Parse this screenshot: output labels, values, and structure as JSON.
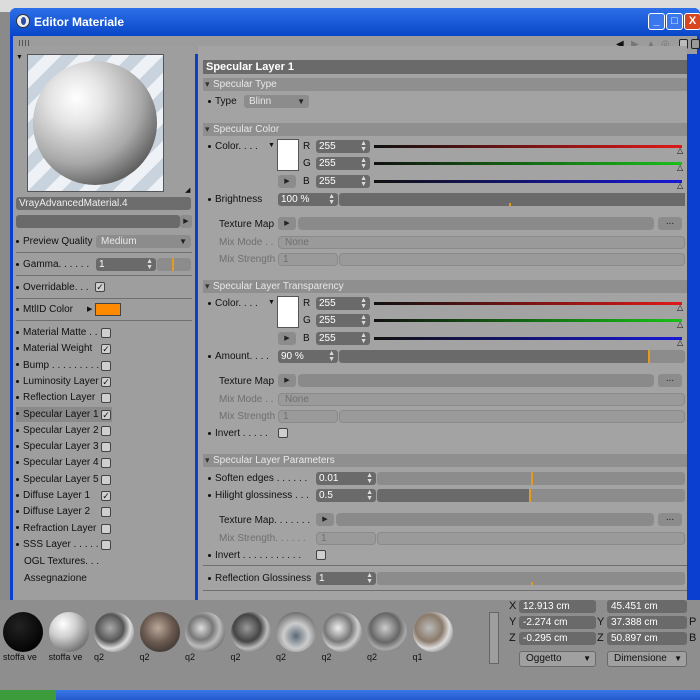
{
  "window": {
    "title": "Editor Materiale",
    "min": "_",
    "max": "□",
    "close": "X"
  },
  "material": {
    "name": "VrayAdvancedMaterial.4"
  },
  "left": {
    "preview_quality_label": "Preview Quality",
    "preview_quality_value": "Medium",
    "gamma_label": "Gamma. . . . . .",
    "gamma_value": "1",
    "overridable_label": "Overridable. . .",
    "mtlid_label": "MtlID Color",
    "mtlid_color": "#ff8a00",
    "channels": [
      {
        "label": "Material Matte . .",
        "checked": false
      },
      {
        "label": "Material Weight",
        "checked": true
      },
      {
        "label": "Bump . . . . . . . . .",
        "checked": false
      },
      {
        "label": "Luminosity Layer",
        "checked": true
      },
      {
        "label": "Reflection Layer",
        "checked": false
      },
      {
        "label": "Specular Layer 1",
        "checked": true
      },
      {
        "label": "Specular Layer 2",
        "checked": false
      },
      {
        "label": "Specular Layer 3",
        "checked": false
      },
      {
        "label": "Specular Layer 4",
        "checked": false
      },
      {
        "label": "Specular Layer 5",
        "checked": false
      },
      {
        "label": "Diffuse Layer 1",
        "checked": true
      },
      {
        "label": "Diffuse Layer 2",
        "checked": false
      },
      {
        "label": "Refraction Layer",
        "checked": false
      },
      {
        "label": "SSS Layer . . . . . .",
        "checked": false
      }
    ],
    "ogl_textures": "OGL Textures. . .",
    "assegnazione": "Assegnazione"
  },
  "right": {
    "header": "Specular Layer 1",
    "type_section": {
      "title": "Specular Type",
      "type_label": "Type",
      "type_value": "Blinn"
    },
    "color_section": {
      "title": "Specular Color",
      "color_label": "Color. . . .",
      "r_label": "R",
      "g_label": "G",
      "b_label": "B",
      "r": "255",
      "g": "255",
      "b": "255",
      "brightness_label": "Brightness",
      "brightness_value": "100 %",
      "texture_map_label": "Texture Map",
      "mix_mode_label": "Mix Mode . .",
      "mix_mode_value": "None",
      "mix_strength_label": "Mix Strength",
      "mix_strength_value": "1",
      "dots": "..."
    },
    "transparency_section": {
      "title": "Specular Layer Transparency",
      "color_label": "Color. . . .",
      "r_label": "R",
      "g_label": "G",
      "b_label": "B",
      "r": "255",
      "g": "255",
      "b": "255",
      "amount_label": "Amount. . . .",
      "amount_value": "90 %",
      "amount_fraction": 0.9,
      "texture_map_label": "Texture Map",
      "mix_mode_label": "Mix Mode . .",
      "mix_mode_value": "None",
      "mix_strength_label": "Mix Strength",
      "mix_strength_value": "1",
      "invert_label": "Invert . . . . .",
      "dots": "..."
    },
    "params_section": {
      "title": "Specular Layer Parameters",
      "soften_label": "Soften edges . . . . . .",
      "soften_value": "0.01",
      "hilight_label": "Hilight glossiness . . .",
      "hilight_value": "0.5",
      "texture_map_label": "Texture Map. . . . . . .",
      "mix_strength_label": "Mix Strength. . . . . .",
      "mix_strength_value": "1",
      "invert_label": "Invert . . . . . . . . . . .",
      "reflection_gloss_label": "Reflection Glossiness",
      "reflection_gloss_value": "1",
      "dots": "..."
    },
    "colors": {
      "red": "#e01818",
      "green": "#18c018",
      "blue": "#1818d8",
      "accent": "#e89a20"
    }
  },
  "materials": [
    {
      "label": "stoffa ve"
    },
    {
      "label": "stoffa ve"
    },
    {
      "label": "q2"
    },
    {
      "label": "q2"
    },
    {
      "label": "q2"
    },
    {
      "label": "q2"
    },
    {
      "label": "q2"
    },
    {
      "label": "q2"
    },
    {
      "label": "q2"
    },
    {
      "label": "q1"
    }
  ],
  "coords": {
    "x_label": "X",
    "y_label": "Y",
    "z_label": "Z",
    "x1": "12.913 cm",
    "y1": "45.451 cm",
    "x2": "-2.274 cm",
    "y2": "37.388 cm",
    "p_label": "P",
    "z1": "-0.295 cm",
    "z2": "50.897 cm",
    "b_label": "B",
    "oggetto": "Oggetto",
    "dimensione": "Dimensione"
  }
}
